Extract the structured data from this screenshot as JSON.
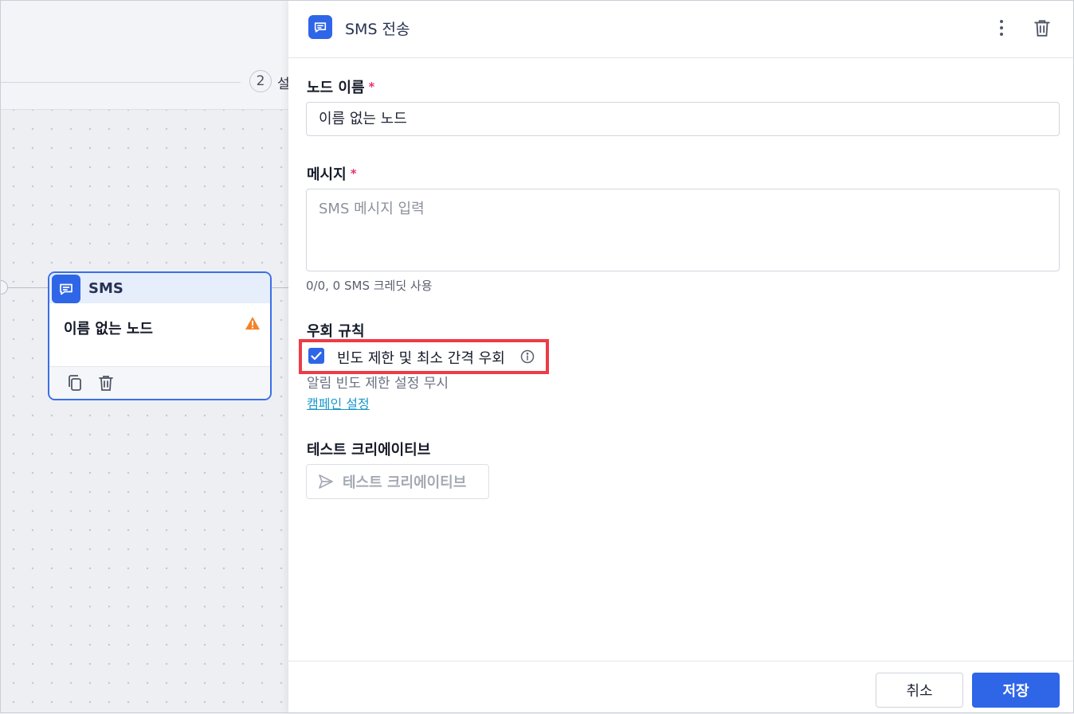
{
  "canvas": {
    "step_number": "2",
    "step_label": "설",
    "node": {
      "type_label": "SMS",
      "name": "이름 없는 노드",
      "warning_icon": "warning-triangle-icon",
      "copy_icon": "copy-icon",
      "delete_icon": "trash-icon"
    }
  },
  "panel": {
    "title": "SMS 전송",
    "header_icon": "message-icon",
    "more_icon": "kebab-menu-icon",
    "delete_icon": "trash-icon",
    "node_name_label": "노드 이름",
    "node_name_value": "이름 없는 노드",
    "required_mark": "*",
    "message_label": "메시지",
    "message_placeholder": "SMS 메시지 입력",
    "message_helper": "0/0, 0 SMS 크레딧 사용",
    "bypass_label": "우회 규칙",
    "bypass_checkbox_label": "빈도 제한 및 최소 간격 우회",
    "bypass_checked": true,
    "bypass_sub": "알림 빈도 제한 설정 무시",
    "campaign_link": "캠페인 설정",
    "test_label": "테스트 크리에이티브",
    "test_button": "테스트 크리에이티브",
    "cancel": "취소",
    "save": "저장"
  },
  "colors": {
    "accent": "#2f66e8",
    "required": "#e6356b",
    "warning": "#f4822a",
    "highlight": "#ee3b46",
    "link": "#1a98cc"
  }
}
